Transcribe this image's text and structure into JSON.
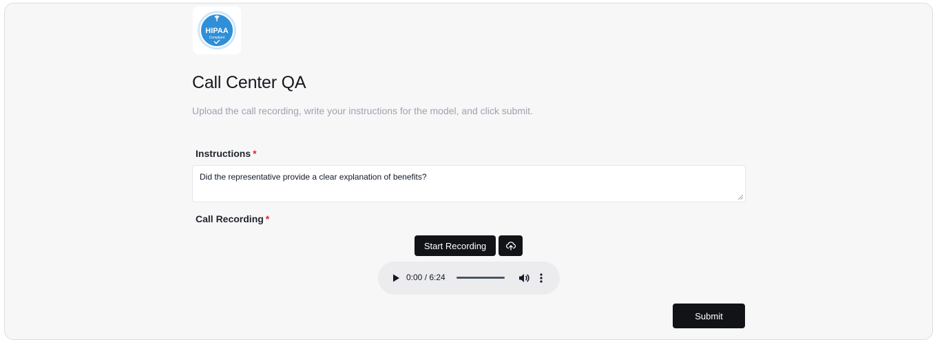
{
  "logo": {
    "main_text": "HIPAA",
    "sub_text": "Compliant",
    "icon": "hipaa-compliant-badge-icon",
    "color": "#2f8fd8"
  },
  "page": {
    "title": "Call Center QA",
    "subtitle": "Upload the call recording, write your instructions for the model, and click submit."
  },
  "instructions": {
    "label": "Instructions",
    "required_marker": "*",
    "value": "Did the representative provide a clear explanation of benefits?"
  },
  "recording": {
    "label": "Call Recording",
    "required_marker": "*",
    "start_label": "Start Recording",
    "upload_icon": "cloud-upload-icon"
  },
  "audio_player": {
    "time_display": "0:00 / 6:24",
    "progress": 0,
    "play_icon": "play-icon",
    "volume_icon": "volume-icon",
    "more_icon": "more-options-icon"
  },
  "actions": {
    "submit_label": "Submit"
  },
  "colors": {
    "button_bg": "#121317",
    "required": "#dc2626",
    "panel_bg": "#f7f7f8"
  }
}
